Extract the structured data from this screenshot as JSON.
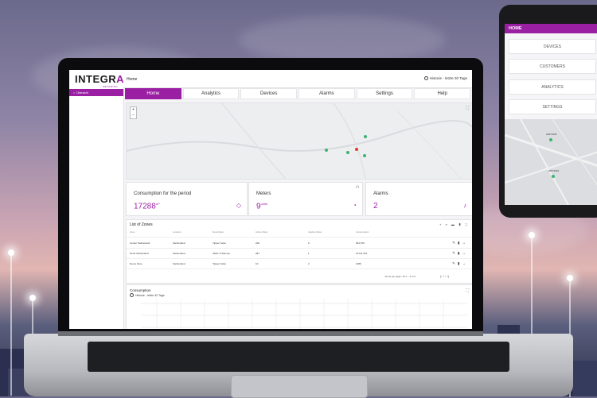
{
  "app": {
    "logo_text": "INTEGR",
    "logo_accent": "A",
    "logo_sub": "METERING",
    "page_label": "Home",
    "history_label": "Historie - letzte 30 Tage",
    "sidebar": [
      {
        "label": "Übersicht",
        "icon": "home-icon"
      }
    ],
    "tabs": [
      {
        "label": "Home",
        "active": true
      },
      {
        "label": "Analytics"
      },
      {
        "label": "Devices"
      },
      {
        "label": "Alarms"
      },
      {
        "label": "Settings"
      },
      {
        "label": "Help"
      }
    ],
    "cards": {
      "consumption": {
        "title": "Consumption for the period",
        "value": "17288",
        "unit": "m³",
        "icon": "drop-icon"
      },
      "meters": {
        "title": "Meters",
        "value": "9",
        "unit": "units",
        "icon": "gauge-icon"
      },
      "alarms": {
        "title": "Alarms",
        "value": "2",
        "icon": "bell-icon"
      }
    },
    "zones": {
      "title": "List of Zones",
      "columns": [
        "Zone",
        "Location",
        "Description",
        "Active Meter",
        "Inactive Meter",
        "Consumption"
      ],
      "rows": [
        [
          "Center Switzerland",
          "Switzerland",
          "Tippen Sobe",
          "240",
          "0",
          "991,970"
        ],
        [
          "North Switzerland",
          "Switzerland",
          "4200 / 6 Rennen",
          "287",
          "1",
          "14741 976"
        ],
        [
          "Demo Zone",
          "Switzerland",
          "Tippen Sobe",
          "10",
          "2",
          "1286"
        ]
      ],
      "pager": "Items per page: 10   1 – 3 of 3"
    },
    "consumption_panel": {
      "title": "Consumption",
      "history": "Historie - letzte 30 Tage"
    }
  },
  "phone": {
    "header": "HOME",
    "buttons": [
      "DEVICES",
      "CUSTOMERS",
      "ANALYTICS",
      "SETTINGS"
    ],
    "map_labels": [
      "20071543",
      "20071561"
    ]
  },
  "colors": {
    "accent": "#9b1fa3",
    "pin_green": "#3cb371",
    "pin_red": "#e53935"
  }
}
